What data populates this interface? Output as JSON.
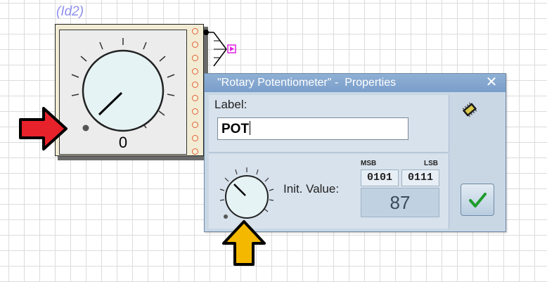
{
  "component": {
    "id_label": "(Id2)",
    "value": "0"
  },
  "dialog": {
    "title": "\"Rotary Potentiometer\" -  Properties",
    "close_glyph": "✕",
    "label_caption": "Label:",
    "label_value": "POT",
    "init_value_caption": "Init. Value:",
    "msb_caption": "MSB",
    "lsb_caption": "LSB",
    "msb_bits": "0101",
    "lsb_bits": "0111",
    "decimal_value": "87"
  },
  "icons": {
    "chip": "chip-icon",
    "ok": "checkmark-icon",
    "arrow_red": "red-arrow-right",
    "arrow_yellow": "yellow-arrow-up"
  },
  "colors": {
    "component_id": "#8f8ff0",
    "pin": "#e0603a",
    "titlebar": "#7a9ecb",
    "dialog_bg": "#c9d7e5",
    "red_arrow": "#e8222a",
    "yellow_arrow": "#f5b800",
    "check": "#1f9c2c"
  }
}
